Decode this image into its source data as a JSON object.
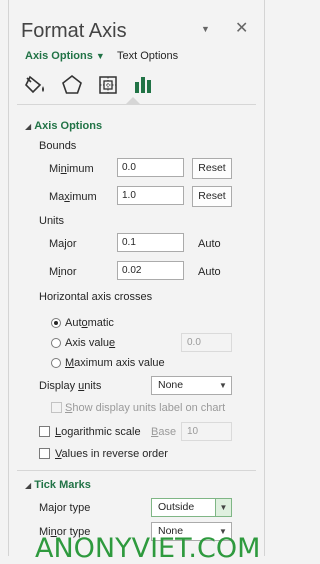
{
  "header": {
    "title": "Format Axis",
    "dropdown_icon": "chevron-down-icon",
    "close_icon": "close-icon"
  },
  "tabs": [
    {
      "label": "Axis Options",
      "active": true
    },
    {
      "label": "Text Options",
      "active": false
    }
  ],
  "icon_tabs": [
    "fill-line-icon",
    "effects-icon",
    "size-properties-icon",
    "axis-options-icon"
  ],
  "axis_options": {
    "heading": "Axis Options",
    "bounds_label": "Bounds",
    "minimum_label_pre": "Mi",
    "minimum_label_u": "n",
    "minimum_label_post": "imum",
    "minimum_value": "0.0",
    "maximum_label_pre": "Ma",
    "maximum_label_u": "x",
    "maximum_label_post": "imum",
    "maximum_value": "1.0",
    "reset_label": "Reset",
    "units_label": "Units",
    "major_label": "Major",
    "major_value": "0.1",
    "minor_label_pre": "M",
    "minor_label_u": "i",
    "minor_label_post": "nor",
    "minor_value": "0.02",
    "auto_label": "Auto",
    "crosses_label": "Horizontal axis crosses",
    "crosses_options": {
      "automatic_pre": "Aut",
      "automatic_u": "o",
      "automatic_post": "matic",
      "axis_value_pre": "Axis valu",
      "axis_value_u": "e",
      "axis_value_field": "0.0",
      "maximum_pre": "",
      "maximum_u": "M",
      "maximum_post": "aximum axis value"
    },
    "display_units_label_pre": "Display ",
    "display_units_label_u": "u",
    "display_units_label_post": "nits",
    "display_units_value": "None",
    "show_units_label_pre": "",
    "show_units_label_u": "S",
    "show_units_label_post": "how display units label on chart",
    "log_scale_pre": "",
    "log_scale_u": "L",
    "log_scale_post": "ogarithmic scale",
    "base_pre": "",
    "base_u": "B",
    "base_post": "ase",
    "base_value": "10",
    "reverse_pre": "",
    "reverse_u": "V",
    "reverse_post": "alues in reverse order"
  },
  "tick_marks": {
    "heading": "Tick Marks",
    "major_type_label": "Major type",
    "major_type_value": "Outside",
    "minor_type_label_pre": "Mi",
    "minor_type_label_u": "n",
    "minor_type_label_post": "or type",
    "minor_type_value": "None"
  },
  "watermark": "ANONYVIET.COM",
  "colors": {
    "accent": "#217346",
    "watermark": "#2e9a3e"
  }
}
